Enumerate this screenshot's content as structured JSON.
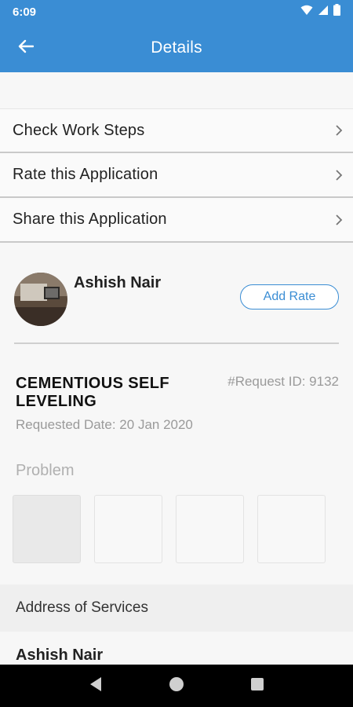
{
  "status_bar": {
    "time": "6:09"
  },
  "app_bar": {
    "title": "Details"
  },
  "menu": {
    "items": [
      {
        "label": "Check Work Steps"
      },
      {
        "label": "Rate this Application"
      },
      {
        "label": "Share this Application"
      }
    ]
  },
  "profile": {
    "name": "Ashish Nair",
    "add_rate_label": "Add Rate"
  },
  "request": {
    "title": "CEMENTIOUS SELF LEVELING",
    "request_id": "#Request ID: 9132",
    "requested_date": "Requested Date: 20 Jan 2020"
  },
  "problem": {
    "label": "Problem"
  },
  "address": {
    "header": "Address of Services",
    "name": "Ashish Nair"
  },
  "colors": {
    "accent": "#3a8dd4",
    "muted_text": "#9a9a9a"
  }
}
